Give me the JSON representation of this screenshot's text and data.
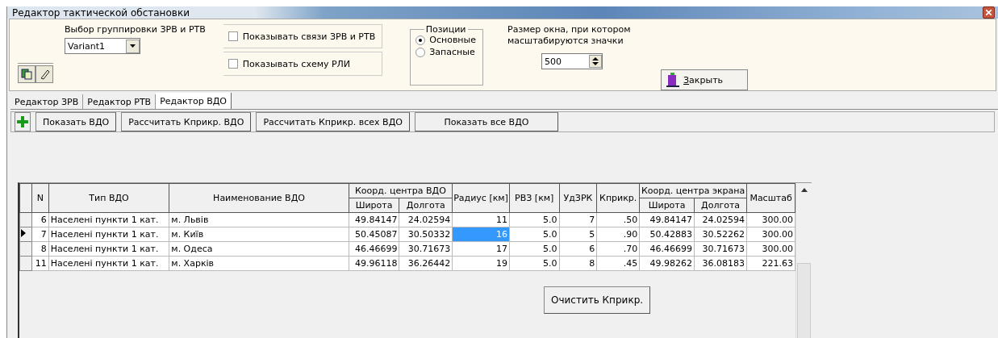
{
  "window": {
    "title": "Редактор тактической обстановки"
  },
  "toolbar": {
    "group_label": "Выбор группировки ЗРВ и РТВ",
    "group_value": "Variant1",
    "checkboxes": [
      {
        "label": "Показывать связи ЗРВ и РТВ",
        "checked": false
      },
      {
        "label": "Показывать схему РЛИ",
        "checked": false
      }
    ],
    "positions": {
      "title": "Позиции",
      "options": [
        {
          "label": "Основные",
          "selected": true
        },
        {
          "label": "Запасные",
          "selected": false
        }
      ]
    },
    "scale_label": "Размер окна, при котором масштабируются значки",
    "scale_value": "500",
    "close_button": "Закрыть"
  },
  "tabs": [
    {
      "label": "Редактор ЗРВ",
      "selected": false
    },
    {
      "label": "Редактор РТВ",
      "selected": false
    },
    {
      "label": "Редактор ВДО",
      "selected": true
    }
  ],
  "actions": [
    "Показать ВДО",
    "Рассчитать Кприкр. ВДО",
    "Рассчитать Кприкр. всех ВДО",
    "Показать все ВДО"
  ],
  "table": {
    "header": [
      {
        "label": "N"
      },
      {
        "label": "Тип ВДО",
        "kind": "text"
      },
      {
        "label": "Наименование ВДО",
        "kind": "text"
      },
      {
        "label": "Коорд. центра ВДО",
        "sub": [
          {
            "label": "Широта"
          },
          {
            "label": "Долгота"
          }
        ]
      },
      {
        "label": "Радиус [км]"
      },
      {
        "label": "РВЗ [км]"
      },
      {
        "label": "УдЗРК"
      },
      {
        "label": "Кприкр."
      },
      {
        "label": "Коорд. центра экрана",
        "sub": [
          {
            "label": "Широта"
          },
          {
            "label": "Долгота"
          }
        ]
      },
      {
        "label": "Масштаб"
      }
    ],
    "rows": [
      {
        "selected": false,
        "cells": [
          {
            "text": "6",
            "selected": false
          },
          {
            "text": "Населені пункти 1 кат.",
            "selected": false
          },
          {
            "text": "м. Львів",
            "selected": false
          },
          {
            "text": "49.84147",
            "selected": false
          },
          {
            "text": "24.02594",
            "selected": false
          },
          {
            "text": "11",
            "selected": false
          },
          {
            "text": "5.0",
            "selected": false
          },
          {
            "text": "7",
            "selected": false
          },
          {
            "text": ".50",
            "selected": false
          },
          {
            "text": "49.84147",
            "selected": false
          },
          {
            "text": "24.02594",
            "selected": false
          },
          {
            "text": "300.00",
            "selected": false
          }
        ]
      },
      {
        "selected": true,
        "cells": [
          {
            "text": "7",
            "selected": false
          },
          {
            "text": "Населені пункти 1 кат.",
            "selected": false
          },
          {
            "text": "м. Київ",
            "selected": false
          },
          {
            "text": "50.45087",
            "selected": false
          },
          {
            "text": "30.50332",
            "selected": false
          },
          {
            "text": "16",
            "selected": true
          },
          {
            "text": "5.0",
            "selected": false
          },
          {
            "text": "5",
            "selected": false
          },
          {
            "text": ".90",
            "selected": false
          },
          {
            "text": "50.42883",
            "selected": false
          },
          {
            "text": "30.52262",
            "selected": false
          },
          {
            "text": "300.00",
            "selected": false
          }
        ]
      },
      {
        "selected": false,
        "cells": [
          {
            "text": "8",
            "selected": false
          },
          {
            "text": "Населені пункти 1 кат.",
            "selected": false
          },
          {
            "text": "м. Одеса",
            "selected": false
          },
          {
            "text": "46.46699",
            "selected": false
          },
          {
            "text": "30.71673",
            "selected": false
          },
          {
            "text": "17",
            "selected": false
          },
          {
            "text": "5.0",
            "selected": false
          },
          {
            "text": "6",
            "selected": false
          },
          {
            "text": ".70",
            "selected": false
          },
          {
            "text": "46.46699",
            "selected": false
          },
          {
            "text": "30.71673",
            "selected": false
          },
          {
            "text": "300.00",
            "selected": false
          }
        ]
      },
      {
        "selected": false,
        "cells": [
          {
            "text": "11",
            "selected": false
          },
          {
            "text": "Населені пункти 1 кат.",
            "selected": false
          },
          {
            "text": "м. Харків",
            "selected": false
          },
          {
            "text": "49.96118",
            "selected": false
          },
          {
            "text": "36.26442",
            "selected": false
          },
          {
            "text": "19",
            "selected": false
          },
          {
            "text": "5.0",
            "selected": false
          },
          {
            "text": "8",
            "selected": false
          },
          {
            "text": ".45",
            "selected": false
          },
          {
            "text": "49.98262",
            "selected": false
          },
          {
            "text": "36.08183",
            "selected": false
          },
          {
            "text": "221.63",
            "selected": false
          }
        ]
      }
    ],
    "clear_button": "Очистить Кприкр."
  }
}
